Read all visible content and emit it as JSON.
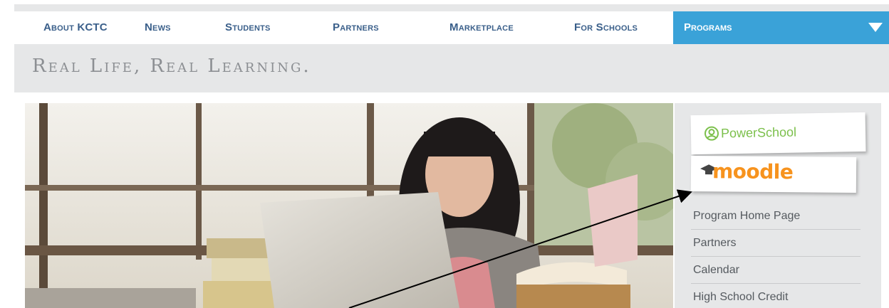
{
  "nav": {
    "items": [
      {
        "label": "About KCTC"
      },
      {
        "label": "News"
      },
      {
        "label": "Students"
      },
      {
        "label": "Partners"
      },
      {
        "label": "Marketplace"
      },
      {
        "label": "For Schools"
      }
    ],
    "active": {
      "label": "Programs"
    }
  },
  "tagline": "Real Life, Real Learning.",
  "sidebar": {
    "powerschool_label": "PowerSchool",
    "moodle_label": "moodle",
    "links": [
      {
        "label": "Program Home Page"
      },
      {
        "label": "Partners"
      },
      {
        "label": "Calendar"
      },
      {
        "label": "High School Credit"
      }
    ]
  },
  "colors": {
    "nav_text": "#3a5f8a",
    "active_tab": "#3aa2d8",
    "powerschool_green": "#7cc04c",
    "moodle_orange": "#f7931e",
    "background": "#e6e7e8"
  },
  "hero_image": "student-with-laptop-and-books"
}
